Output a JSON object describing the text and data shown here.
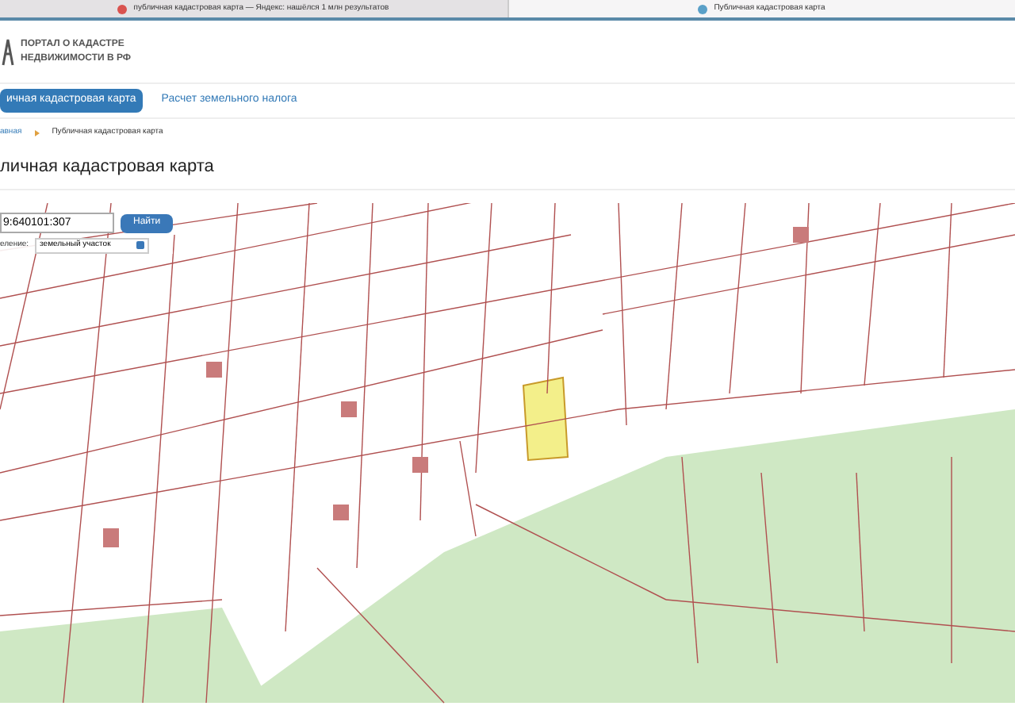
{
  "browser_tabs": [
    {
      "label": "публичная кадастровая карта — Яндекс: нашёлся 1 млн результатов",
      "selected": false
    },
    {
      "label": "Публичная кадастровая карта",
      "selected": true
    }
  ],
  "logo": {
    "line_1": "ПОРТАЛ О КАДАСТРЕ",
    "line_2": "НЕДВИЖИМОСТИ В РФ"
  },
  "nav": [
    {
      "label": "ичная кадастровая карта",
      "selected": true
    },
    {
      "label": "Расчет земельного налога",
      "selected": false
    }
  ],
  "breadcrumb": [
    "авная",
    "Публичная кадастровая карта"
  ],
  "page_title": "личная кадастровая карта",
  "map_search": {
    "value": "9:640101:307",
    "button": "Найти",
    "select_label": "еление:",
    "select_value": "земельный участок"
  }
}
